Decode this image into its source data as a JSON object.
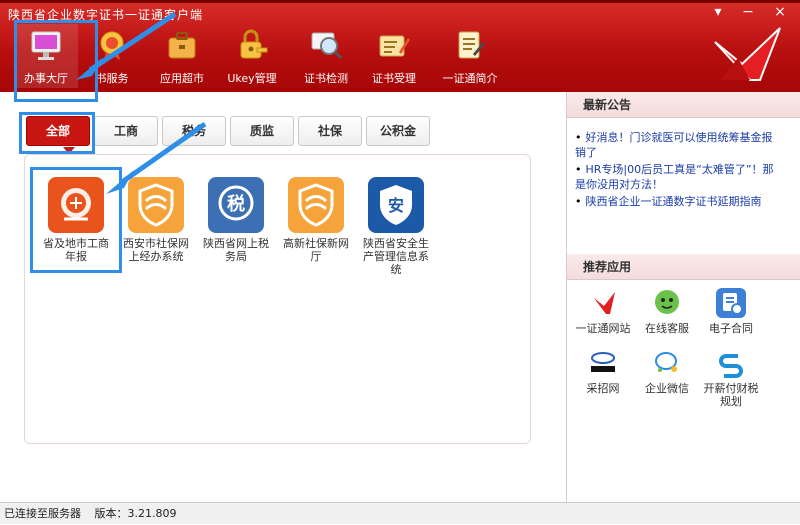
{
  "window": {
    "title": "陕西省企业数字证书一证通客户端"
  },
  "nav": [
    {
      "label": "办事大厅",
      "icon": "monitor-icon"
    },
    {
      "label": "书服务",
      "icon": "certificate-seal-icon"
    },
    {
      "label": "应用超市",
      "icon": "briefcase-icon"
    },
    {
      "label": "Ukey管理",
      "icon": "key-lock-icon"
    },
    {
      "label": "证书检测",
      "icon": "magnifier-icon"
    },
    {
      "label": "证书受理",
      "icon": "edit-card-icon"
    },
    {
      "label": "一证通简介",
      "icon": "notepad-icon"
    }
  ],
  "tabs": [
    "全部",
    "工商",
    "税务",
    "质监",
    "社保",
    "公积金"
  ],
  "apps": [
    {
      "label": "省及地市工商年报",
      "icon": "emblem-icon",
      "color": "#e8541c"
    },
    {
      "label": "西安市社保网上经办系统",
      "icon": "shield-wave-icon",
      "color": "#f5a33a"
    },
    {
      "label": "陕西省网上税务局",
      "icon": "tax-icon",
      "color": "#3c6fb4"
    },
    {
      "label": "高新社保新网厅",
      "icon": "shield-wave-icon",
      "color": "#f5a33a"
    },
    {
      "label": "陕西省安全生产管理信息系统",
      "icon": "safety-shield-icon",
      "color": "#1c5aa8"
    }
  ],
  "sidebar": {
    "news_title": "最新公告",
    "news": [
      "好消息！门诊就医可以使用统筹基金报销了",
      "HR专场|00后员工真是“太难管了”！那是你没用对方法！",
      "陕西省企业一证通数字证书延期指南"
    ],
    "rec_title": "推荐应用",
    "rec": [
      {
        "label": "一证通网站",
        "icon": "red-flag-logo-icon"
      },
      {
        "label": "在线客服",
        "icon": "chat-bubble-face-icon"
      },
      {
        "label": "电子合同",
        "icon": "contract-icon"
      },
      {
        "label": "采招网",
        "icon": "procurement-logo-icon"
      },
      {
        "label": "企业微信",
        "icon": "wecom-icon"
      },
      {
        "label": "开薪付财税规划",
        "icon": "finance-logo-icon"
      }
    ]
  },
  "status": {
    "connection": "已连接至服务器",
    "version_label": "版本：3.21.809"
  },
  "colors": {
    "brand_red": "#c81612",
    "highlight_blue": "#2f8fe8"
  }
}
